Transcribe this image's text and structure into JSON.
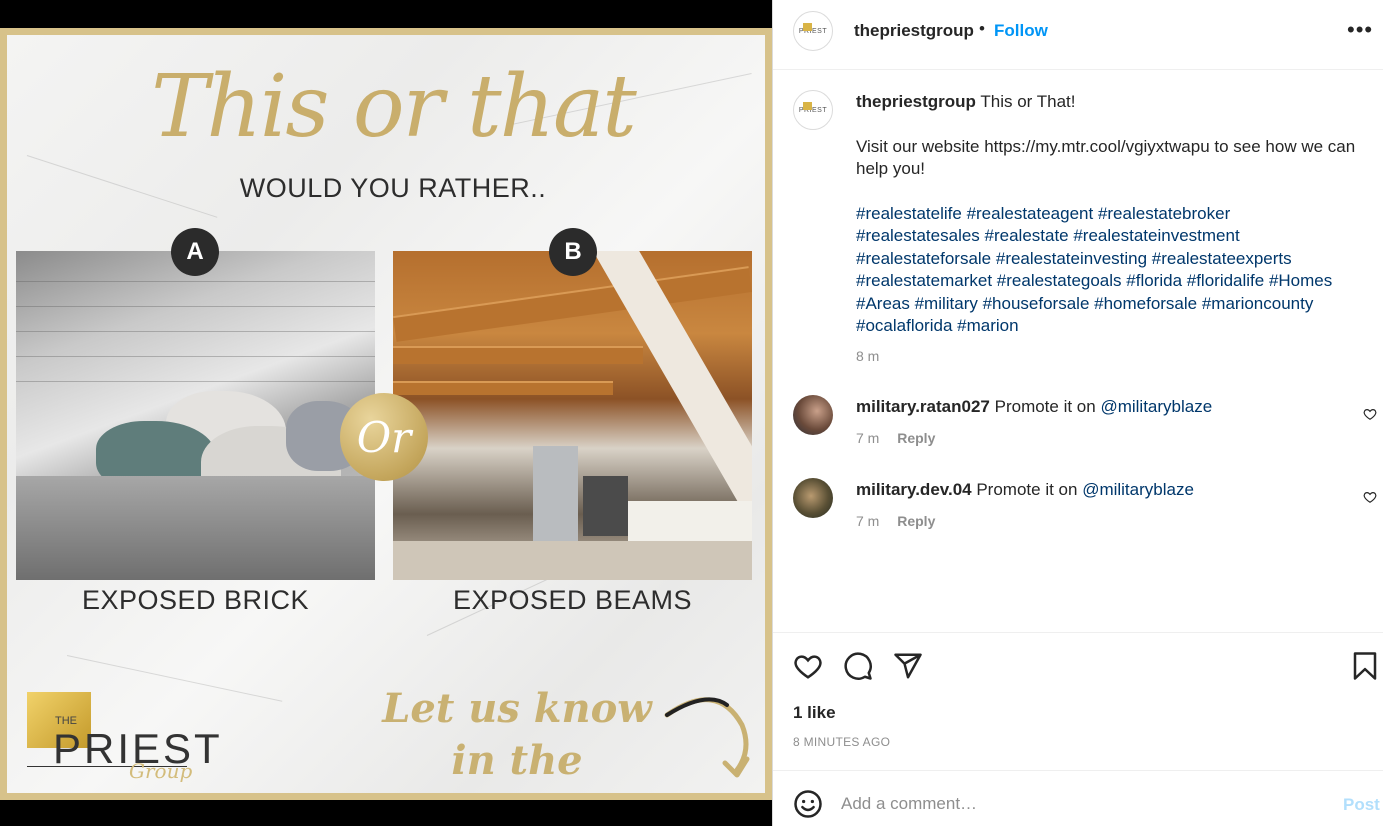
{
  "post_image": {
    "title_script": "This or that",
    "subtitle": "WOULD YOU RATHER..",
    "option_a": {
      "badge": "A",
      "caption": "EXPOSED BRICK"
    },
    "option_b": {
      "badge": "B",
      "caption": "EXPOSED BEAMS"
    },
    "or_label": "Or",
    "logo": {
      "the": "THE",
      "name": "PRIEST",
      "group": "Group"
    },
    "cta_line1": "Let us know",
    "cta_line2": "in the comments!"
  },
  "header": {
    "avatar_text": "PRIEST",
    "username": "thepriestgroup",
    "separator": "•",
    "follow_label": "Follow",
    "more_icon": "more-horizontal-icon"
  },
  "caption": {
    "username": "thepriestgroup",
    "title": "This or That!",
    "line2": "Visit our website https://my.mtr.cool/vgiyxtwapu to see how we can help you!",
    "hashtags": "#realestatelife #realestateagent #realestatebroker #realestatesales #realestate #realestateinvestment #realestateforsale #realestateinvesting #realestateexperts #realestatemarket #realestategoals #florida #floridalife #Homes #Areas #military #houseforsale #homeforsale #marioncounty #ocalaflorida #marion",
    "time": "8 m"
  },
  "comments": [
    {
      "username": "military.ratan027",
      "text": "Promote it on",
      "mention": "@militaryblaze",
      "time": "7 m",
      "reply": "Reply"
    },
    {
      "username": "military.dev.04",
      "text": "Promote it on",
      "mention": "@militaryblaze",
      "time": "7 m",
      "reply": "Reply"
    }
  ],
  "actions": {
    "icons": [
      "heart-icon",
      "comment-icon",
      "share-icon",
      "bookmark-icon"
    ],
    "likes": "1 like",
    "time_ago": "8 MINUTES AGO"
  },
  "add_comment": {
    "placeholder": "Add a comment…",
    "post_label": "Post"
  },
  "colors": {
    "follow_blue": "#0095f6",
    "post_disabled": "#b2dffc",
    "hashtag": "#00376b",
    "gold": "#c9ae6c"
  }
}
